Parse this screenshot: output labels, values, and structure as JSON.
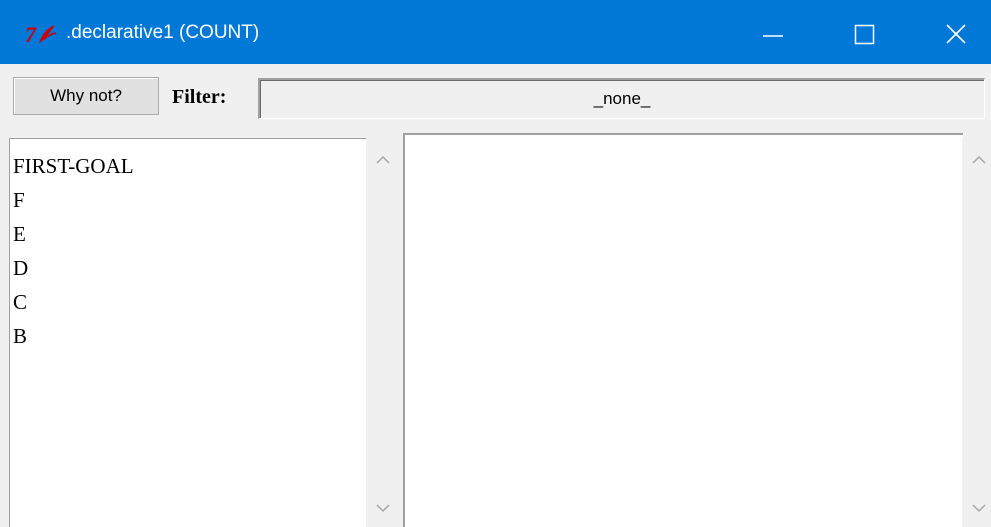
{
  "window": {
    "title": ".declarative1 (COUNT)",
    "app_icon": "tk-feather-icon",
    "accent_color": "#0078d7"
  },
  "toolbar": {
    "why_not_label": "Why not?",
    "filter_label": "Filter:",
    "filter_value": "_none_"
  },
  "goal_list": {
    "items": [
      "FIRST-GOAL",
      "F",
      "E",
      "D",
      "C",
      "B"
    ]
  },
  "icons": {
    "minimize": "minimize-icon",
    "maximize": "maximize-icon",
    "close": "close-icon",
    "scroll_up": "chevron-up-icon",
    "scroll_down": "chevron-down-icon"
  }
}
